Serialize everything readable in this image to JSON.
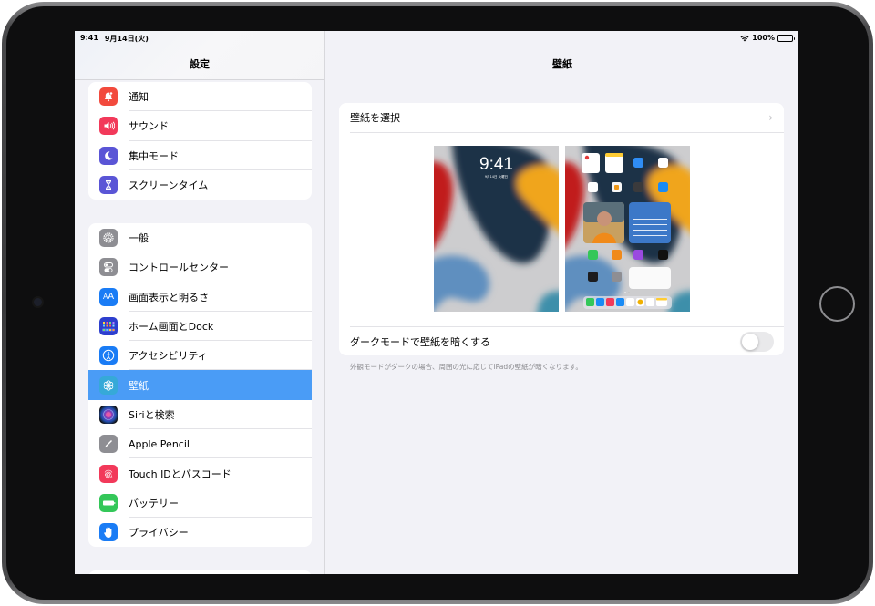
{
  "status_bar": {
    "time": "9:41",
    "date": "9月14日(火)",
    "battery": "100%",
    "wifi_icon": "wifi-icon",
    "battery_icon": "battery-full-icon"
  },
  "sidebar": {
    "title": "設定",
    "groups": [
      {
        "items": [
          {
            "label": "通知",
            "icon": "bell-icon",
            "color": "#f24a3d"
          },
          {
            "label": "サウンド",
            "icon": "speaker-icon",
            "color": "#f2395a"
          },
          {
            "label": "集中モード",
            "icon": "moon-icon",
            "color": "#5a55d6"
          },
          {
            "label": "スクリーンタイム",
            "icon": "hourglass-icon",
            "color": "#5a55d6"
          }
        ]
      },
      {
        "items": [
          {
            "label": "一般",
            "icon": "gear-icon",
            "color": "#8e8e93"
          },
          {
            "label": "コントロールセンター",
            "icon": "toggles-icon",
            "color": "#8e8e93"
          },
          {
            "label": "画面表示と明るさ",
            "icon": "text-size-icon",
            "color": "#1a7cf5"
          },
          {
            "label": "ホーム画面とDock",
            "icon": "app-grid-icon",
            "color": "#2e3fce"
          },
          {
            "label": "アクセシビリティ",
            "icon": "accessibility-icon",
            "color": "#1a7cf5"
          },
          {
            "label": "壁紙",
            "icon": "flower-icon",
            "color": "#36a9d8",
            "selected": true
          },
          {
            "label": "Siriと検索",
            "icon": "siri-icon",
            "color": "#222"
          },
          {
            "label": "Apple Pencil",
            "icon": "pencil-icon",
            "color": "#8e8e93"
          },
          {
            "label": "Touch IDとパスコード",
            "icon": "fingerprint-icon",
            "color": "#f2395a"
          },
          {
            "label": "バッテリー",
            "icon": "battery-icon",
            "color": "#34c759"
          },
          {
            "label": "プライバシー",
            "icon": "hand-icon",
            "color": "#1a7cf5"
          }
        ]
      }
    ]
  },
  "detail": {
    "title": "壁紙",
    "choose_label": "壁紙を選択",
    "lock_screen": {
      "time": "9:41",
      "date": "9月14日 火曜日"
    },
    "dark_mode_label": "ダークモードで壁紙を暗くする",
    "dark_mode_enabled": false,
    "footnote": "外観モードがダークの場合、周囲の光に応じてiPadの壁紙が暗くなります。"
  }
}
